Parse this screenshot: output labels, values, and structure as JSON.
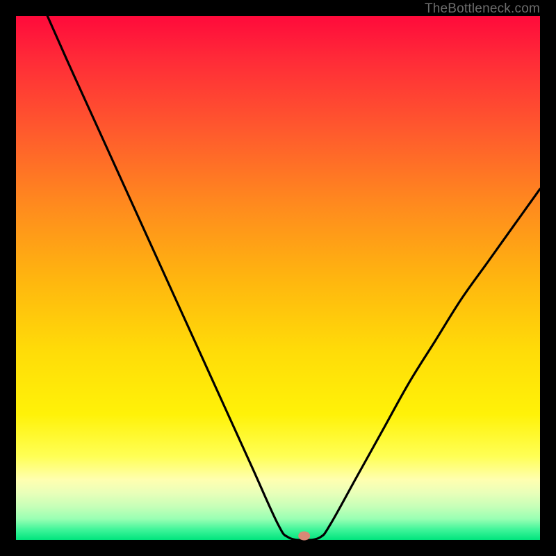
{
  "watermark": "TheBottleneck.com",
  "chart_data": {
    "type": "line",
    "title": "",
    "xlabel": "",
    "ylabel": "",
    "xlim": [
      0,
      100
    ],
    "ylim": [
      0,
      100
    ],
    "grid": false,
    "curve": {
      "description": "V-shaped bottleneck curve reaching minimum near x≈55",
      "x": [
        6,
        10,
        15,
        20,
        25,
        30,
        35,
        40,
        45,
        50,
        52,
        55,
        58,
        60,
        65,
        70,
        75,
        80,
        85,
        90,
        95,
        100
      ],
      "y": [
        100,
        91,
        80,
        69,
        58,
        47,
        36,
        25,
        14,
        3,
        0.5,
        0,
        0.5,
        3,
        12,
        21,
        30,
        38,
        46,
        53,
        60,
        67
      ]
    },
    "marker": {
      "x": 55,
      "y": 0,
      "color": "#d98876"
    }
  },
  "colors": {
    "frame": "#000000",
    "curve": "#000000",
    "marker": "#d98876",
    "watermark": "#6c6c6c"
  }
}
